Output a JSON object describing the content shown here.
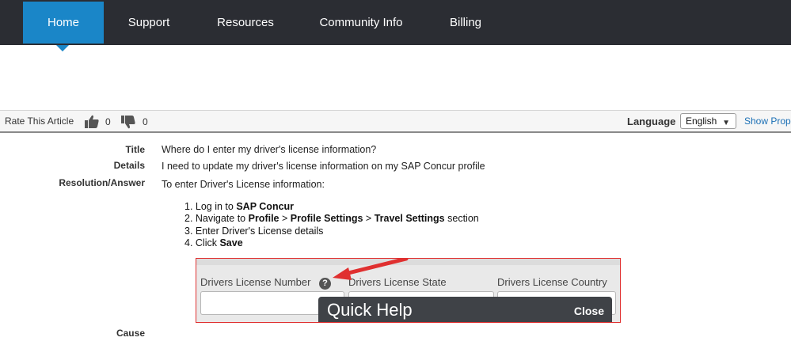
{
  "nav": {
    "items": [
      {
        "label": "Home",
        "active": true
      },
      {
        "label": "Support",
        "active": false
      },
      {
        "label": "Resources",
        "active": false
      },
      {
        "label": "Community Info",
        "active": false
      },
      {
        "label": "Billing",
        "active": false
      }
    ]
  },
  "rating": {
    "label": "Rate This Article",
    "thumbs_up_count": "0",
    "thumbs_down_count": "0"
  },
  "language": {
    "label": "Language",
    "selected": "English",
    "show_properties": "Show Prope"
  },
  "article": {
    "title_label": "Title",
    "title": "Where do I enter my driver's license information?",
    "details_label": "Details",
    "details": "I need to update my driver's license information on my SAP Concur profile",
    "resolution_label": "Resolution/Answer",
    "resolution_intro": "To enter Driver's License information:",
    "steps": [
      {
        "prefix": "1. Log in to ",
        "b1": "SAP Concur",
        "mid": "",
        "b2": "",
        "mid2": "",
        "b3": "",
        "suffix": ""
      },
      {
        "prefix": "2. Navigate to ",
        "b1": "Profile",
        "mid": " > ",
        "b2": "Profile Settings",
        "mid2": " > ",
        "b3": "Travel Settings",
        "suffix": " section"
      },
      {
        "prefix": "3. Enter Driver's License details",
        "b1": "",
        "mid": "",
        "b2": "",
        "mid2": "",
        "b3": "",
        "suffix": ""
      },
      {
        "prefix": "4. Click ",
        "b1": "Save",
        "mid": "",
        "b2": "",
        "mid2": "",
        "b3": "",
        "suffix": ""
      }
    ],
    "cause_label": "Cause"
  },
  "embedded_screenshot": {
    "license_number_label": "Drivers License Number",
    "license_state_label": "Drivers License State",
    "license_country_label": "Drivers License Country",
    "quick_help_title": "Quick Help",
    "quick_help_close": "Close",
    "accent_color": "#e03030"
  },
  "colors": {
    "nav_bg": "#2b2d33",
    "nav_active": "#1a86c8",
    "link": "#1a6fb5"
  }
}
